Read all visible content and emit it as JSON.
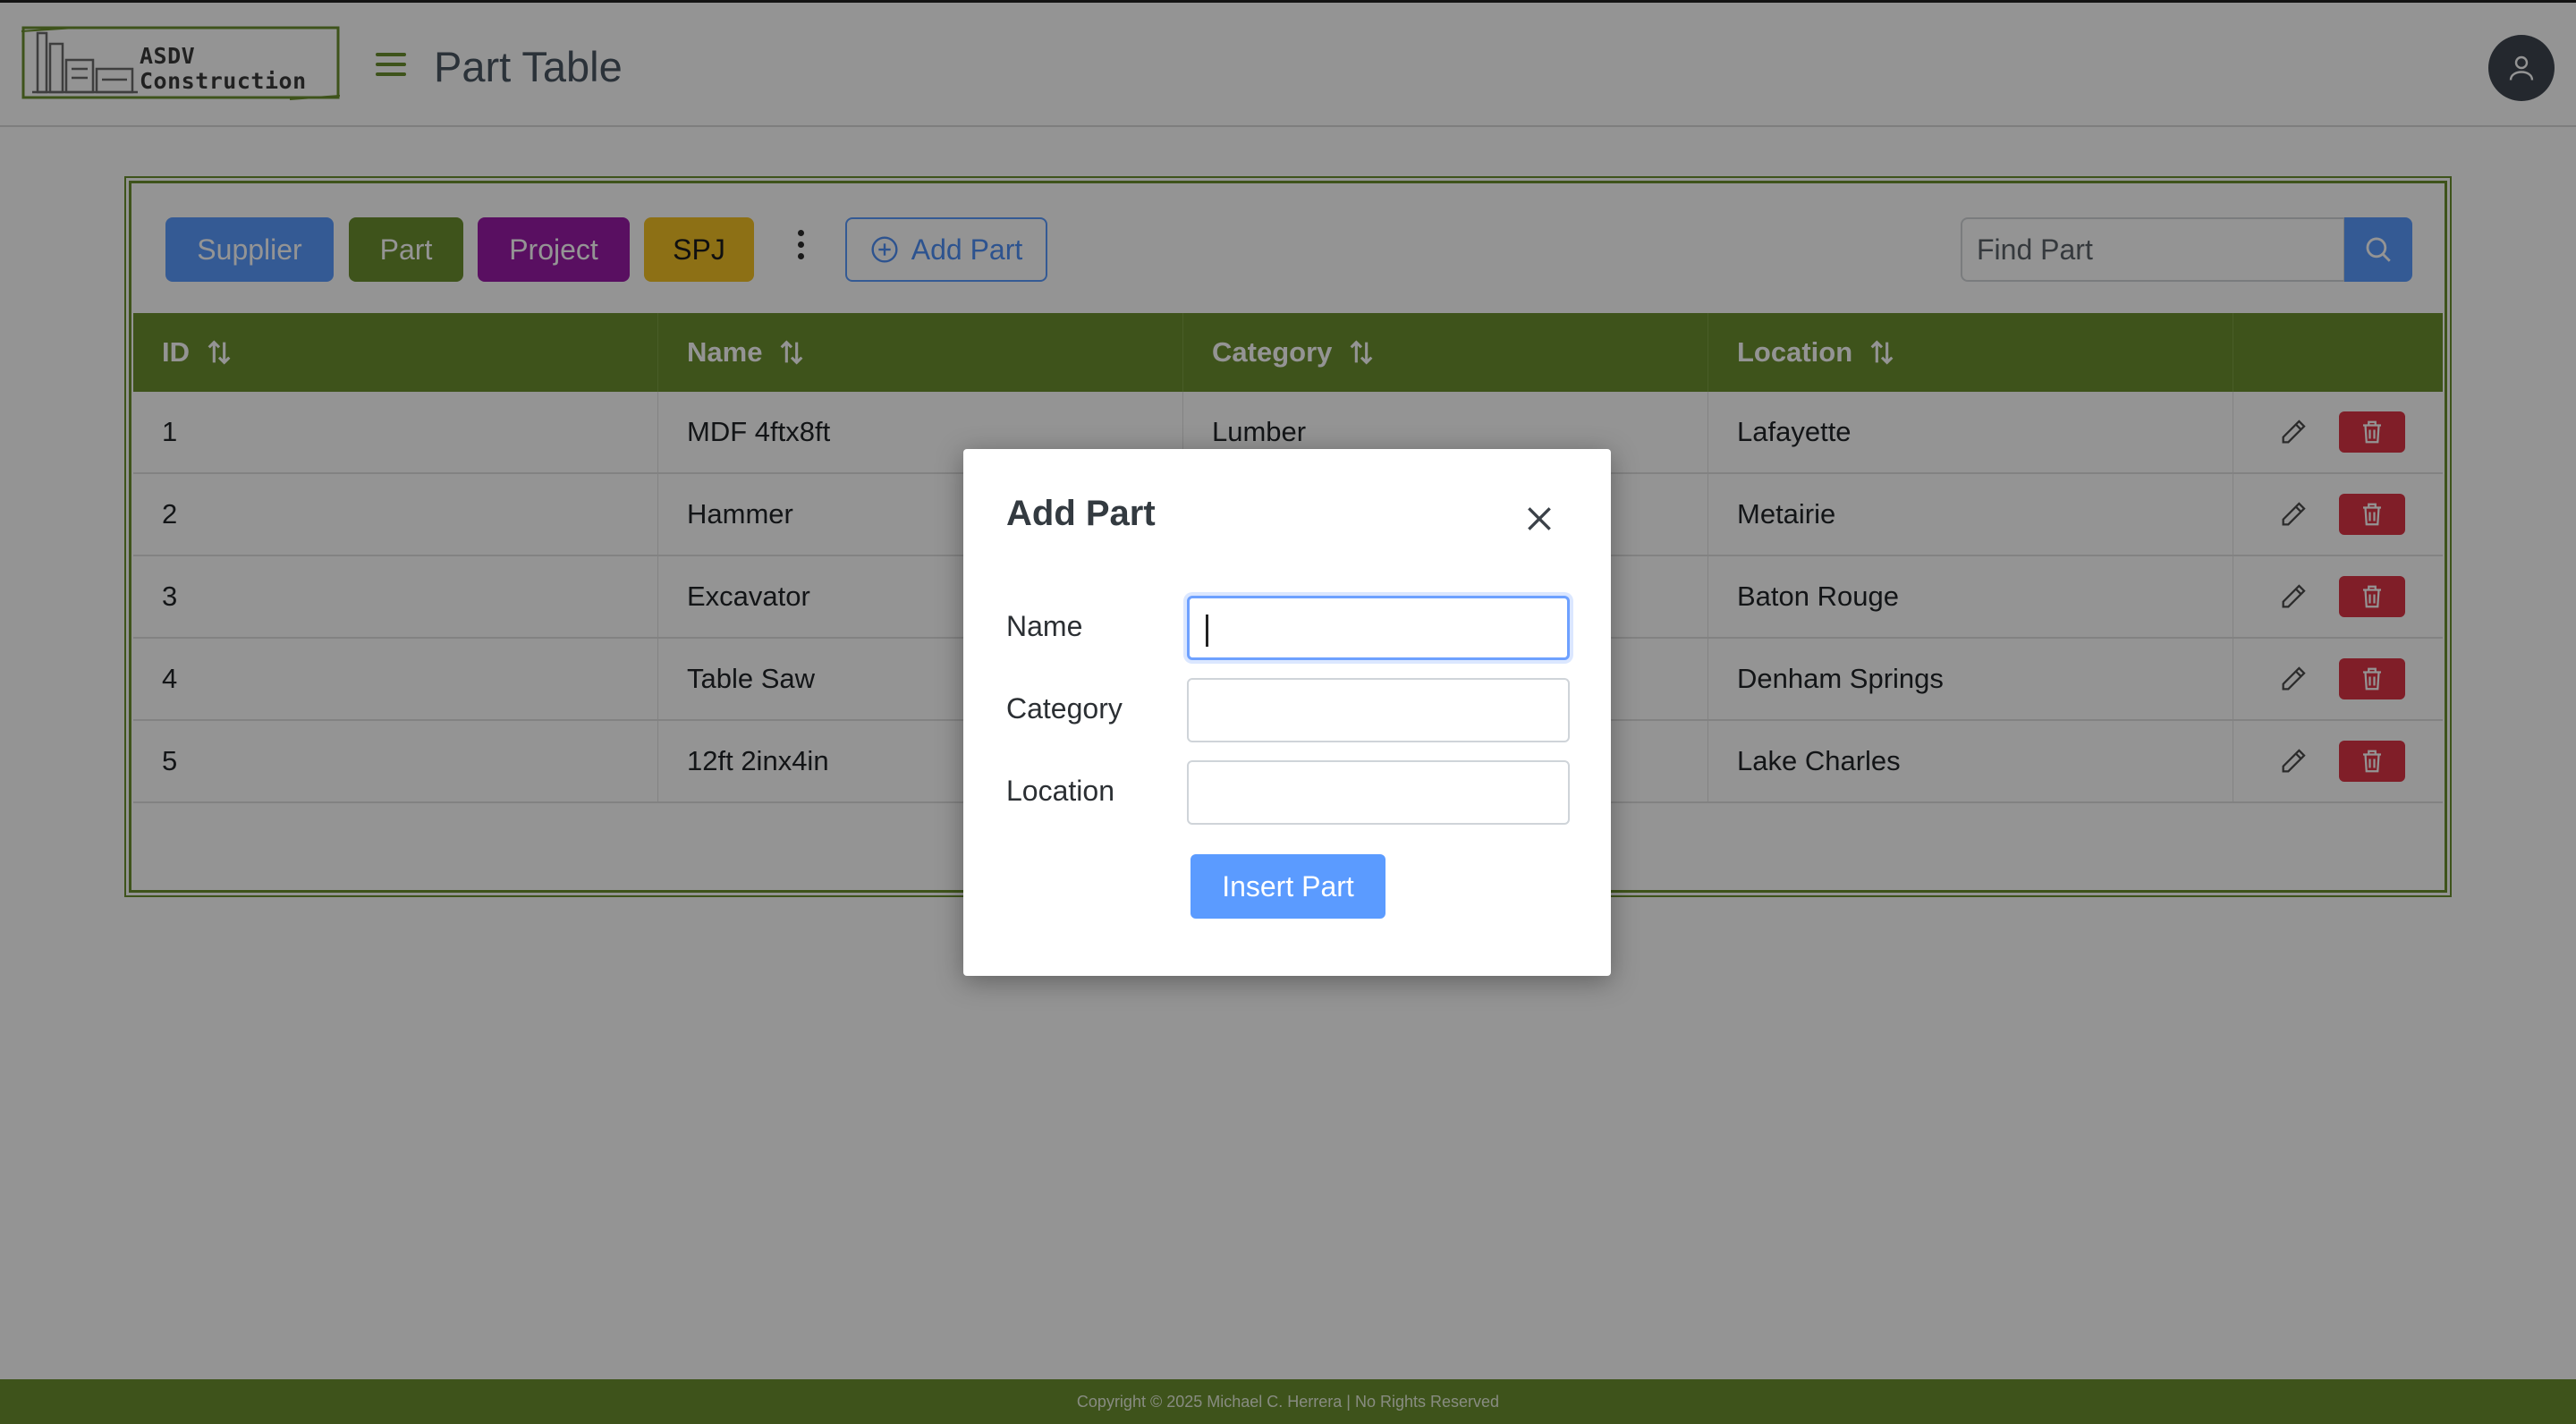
{
  "header": {
    "logo_line1": "ASDV",
    "logo_line2": "Construction",
    "title": "Part Table",
    "user_icon": "user-icon",
    "menu_icon": "hamburger-icon"
  },
  "toolbar": {
    "nav_buttons": [
      "Supplier",
      "Part",
      "Project",
      "SPJ"
    ],
    "add_label": "Add Part",
    "search_placeholder": "Find Part"
  },
  "table": {
    "columns": [
      "ID",
      "Name",
      "Category",
      "Location"
    ],
    "rows": [
      {
        "id": "1",
        "name": "MDF 4ftx8ft",
        "category": "Lumber",
        "location": "Lafayette"
      },
      {
        "id": "2",
        "name": "Hammer",
        "category": "",
        "location": "Metairie"
      },
      {
        "id": "3",
        "name": "Excavator",
        "category": "",
        "location": "Baton Rouge"
      },
      {
        "id": "4",
        "name": "Table Saw",
        "category": "",
        "location": "Denham Springs"
      },
      {
        "id": "5",
        "name": "12ft 2inx4in",
        "category": "",
        "location": "Lake Charles"
      }
    ]
  },
  "modal": {
    "title": "Add Part",
    "fields": [
      {
        "label": "Name",
        "value": ""
      },
      {
        "label": "Category",
        "value": ""
      },
      {
        "label": "Location",
        "value": ""
      }
    ],
    "submit_label": "Insert Part"
  },
  "footer": {
    "text": "Copyright © 2025 Michael C. Herrera  |  No Rights Reserved"
  },
  "colors": {
    "brand_green": "#6b8f2f",
    "primary_blue": "#5b9bff",
    "project_purple": "#9a1aa8",
    "spj_yellow": "#f3c125",
    "danger_red": "#dc3545"
  }
}
